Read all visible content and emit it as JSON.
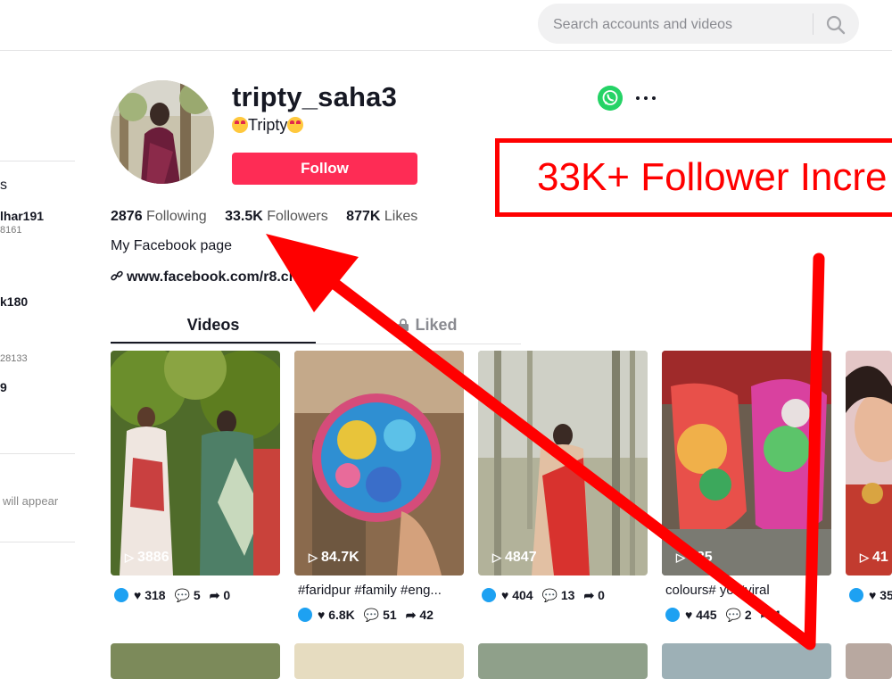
{
  "search": {
    "placeholder": "Search accounts and videos"
  },
  "sidebar": {
    "fragments": [
      {
        "text": "s",
        "size": "12px",
        "color": "#555",
        "bold": false
      },
      {
        "text": "lhar191",
        "size": "14px",
        "color": "#161823",
        "bold": true
      },
      {
        "text": "8161",
        "size": "11px",
        "color": "#777",
        "bold": false
      },
      {
        "text": "k180",
        "size": "14px",
        "color": "#161823",
        "bold": true
      },
      {
        "text": "28133",
        "size": "11px",
        "color": "#777",
        "bold": false
      },
      {
        "text": "9",
        "size": "14px",
        "color": "#161823",
        "bold": true
      },
      {
        "text": "will appear",
        "size": "13px",
        "color": "#888",
        "bold": false
      }
    ]
  },
  "profile": {
    "username": "tripty_saha3",
    "nickname": "Tripty",
    "follow_label": "Follow",
    "stats": {
      "following_count": "2876",
      "following_label": "Following",
      "followers_count": "33.5K",
      "followers_label": "Followers",
      "likes_count": "877K",
      "likes_label": "Likes"
    },
    "bio": "My Facebook page",
    "link": "www.facebook.com/r8.ch"
  },
  "tabs": {
    "videos": "Videos",
    "liked": "Liked"
  },
  "videos": [
    {
      "views": "3886",
      "caption": "",
      "likes": "318",
      "comments": "5",
      "shares": "0"
    },
    {
      "views": "84.7K",
      "caption": "#faridpur #family #eng...",
      "likes": "6.8K",
      "comments": "51",
      "shares": "42"
    },
    {
      "views": "4847",
      "caption": "",
      "likes": "404",
      "comments": "13",
      "shares": "0"
    },
    {
      "views": "385",
      "caption": "colours# yo #viral",
      "likes": "445",
      "comments": "2",
      "shares": "1"
    },
    {
      "views": "41",
      "caption": "",
      "likes": "35",
      "comments": "",
      "shares": ""
    }
  ],
  "annotation": {
    "text": "33K+ Follower Incre"
  },
  "colors": {
    "follow": "#fe2c55",
    "annotation": "#ff0000",
    "whatsapp": "#25d366"
  }
}
